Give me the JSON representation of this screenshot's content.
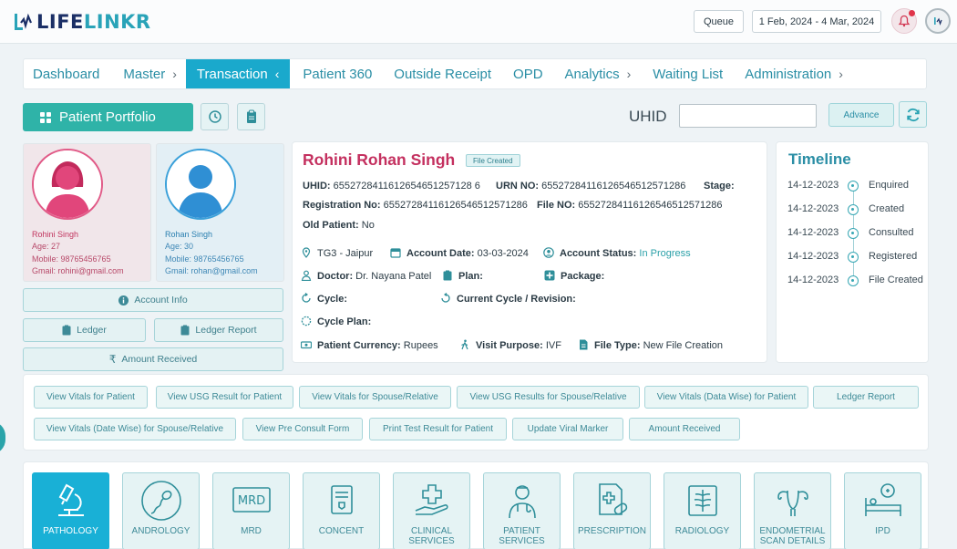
{
  "header": {
    "logo_text_a": "LIFE",
    "logo_text_b": "LINKR",
    "queue_label": "Queue",
    "date_range": "1 Feb, 2024 - 4 Mar, 2024"
  },
  "nav": [
    {
      "label": "Dashboard"
    },
    {
      "label": "Master",
      "chevron": "›"
    },
    {
      "label": "Transaction",
      "chevron": "‹"
    },
    {
      "label": "Patient 360"
    },
    {
      "label": "Outside Receipt"
    },
    {
      "label": "OPD"
    },
    {
      "label": "Analytics",
      "chevron": "›"
    },
    {
      "label": "Waiting List"
    },
    {
      "label": "Administration",
      "chevron": "›"
    }
  ],
  "toolbar": {
    "portfolio_label": "Patient Portfolio",
    "uhid_label": "UHID",
    "uhid_value": "",
    "advance_label": "Advance"
  },
  "patient": {
    "name": "Rohini Singh",
    "age": "Age: 27",
    "mobile": "Mobile: 98765456765",
    "gmail": "Gmail: rohini@gmail.com"
  },
  "spouse": {
    "name": "Rohan Singh",
    "age": "Age: 30",
    "mobile": "Mobile: 98765456765",
    "gmail": "Gmail: rohan@gmail.com"
  },
  "left_buttons": {
    "account_info": "Account Info",
    "ledger": "Ledger",
    "ledger_report": "Ledger Report",
    "amount_received": "Amount Received"
  },
  "details": {
    "full_name": "Rohini Rohan Singh",
    "badge": "File Created",
    "uhid_label": "UHID:",
    "uhid_value": "6552728411612654651257128 6",
    "urn_label": "URN NO:",
    "urn_value": "65527284116126546512571286",
    "stage_label": "Stage:",
    "reg_label": "Registration No:",
    "reg_value": "65527284116126546512571286",
    "file_no_label": "File NO:",
    "file_no_value": "65527284116126546512571286",
    "old_patient_label": "Old Patient:",
    "old_patient_value": "No",
    "location": "TG3 - Jaipur",
    "account_date_label": "Account Date:",
    "account_date_value": "03-03-2024",
    "account_status_label": "Account Status:",
    "account_status_value": "In Progress",
    "doctor_label": "Doctor:",
    "doctor_value": "Dr. Nayana Patel",
    "plan_label": "Plan:",
    "package_label": "Package:",
    "cycle_label": "Cycle:",
    "current_cycle_label": "Current Cycle / Revision:",
    "cycle_plan_label": "Cycle Plan:",
    "currency_label": "Patient Currency:",
    "currency_value": "Rupees",
    "visit_purpose_label": "Visit Purpose:",
    "visit_purpose_value": "IVF",
    "file_type_label": "File Type:",
    "file_type_value": "New File Creation"
  },
  "timeline": {
    "title": "Timeline",
    "entries": [
      {
        "date": "14-12-2023",
        "status": "Enquired"
      },
      {
        "date": "14-12-2023",
        "status": "Created"
      },
      {
        "date": "14-12-2023",
        "status": "Consulted"
      },
      {
        "date": "14-12-2023",
        "status": "Registered"
      },
      {
        "date": "14-12-2023",
        "status": "File Created"
      }
    ]
  },
  "actions": [
    "View Vitals for Patient",
    "View USG Result for Patient",
    "View Vitals for Spouse/Relative",
    "View USG Results for Spouse/Relative",
    "View Vitals (Data Wise) for Patient",
    "Ledger Report",
    "View Vitals (Date Wise) for Spouse/Relative",
    "View Pre Consult Form",
    "Print Test Result for Patient",
    "Update Viral Marker",
    "Amount Received"
  ],
  "services": [
    {
      "label": "PATHOLOGY",
      "icon": "microscope-icon"
    },
    {
      "label": "ANDROLOGY",
      "icon": "sperm-icon"
    },
    {
      "label": "MRD",
      "icon": "mrd-icon"
    },
    {
      "label": "CONCENT",
      "icon": "consent-form-icon"
    },
    {
      "label": "CLINICAL SERVICES",
      "icon": "clinical-hand-icon"
    },
    {
      "label": "PATIENT SERVICES",
      "icon": "doctor-icon"
    },
    {
      "label": "PRESCRIPTION",
      "icon": "prescription-icon"
    },
    {
      "label": "RADIOLOGY",
      "icon": "xray-icon"
    },
    {
      "label": "ENDOMETRIAL SCAN DETAILS",
      "icon": "uterus-icon"
    },
    {
      "label": "IPD",
      "icon": "hospital-bed-icon"
    }
  ]
}
